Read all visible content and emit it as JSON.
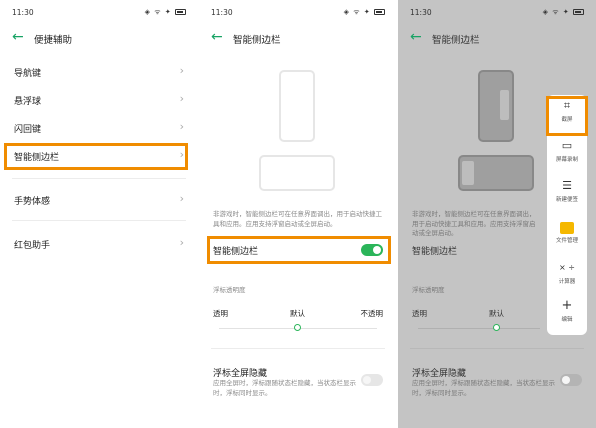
{
  "status": {
    "time": "11:30",
    "icons": "◈ ᯤ ✦"
  },
  "panel1": {
    "title": "便捷辅助",
    "items": [
      {
        "label": "导航键"
      },
      {
        "label": "悬浮球"
      },
      {
        "label": "闪回键"
      },
      {
        "label": "智能侧边栏"
      },
      {
        "label": "手势体感"
      },
      {
        "label": "红包助手"
      }
    ],
    "chevron": "›"
  },
  "panel2": {
    "title": "智能侧边栏",
    "description": "非游戏时，智能侧边栏可在任意界面调出，用于启动快捷工具和应用。应用支持浮窗启动或全屏启动。",
    "toggle_label": "智能侧边栏",
    "toggle_on": true,
    "opacity_section": "浮标透明度",
    "slider_labels": {
      "left": "透明",
      "center": "默认",
      "right": "不透明"
    },
    "slider_value": "默认",
    "fullscreen_hide_title": "浮标全屏隐藏",
    "fullscreen_hide_desc": "应用全屏时，浮标跟随状态栏隐藏，当状态栏显示时，浮标同时显示。",
    "fullscreen_hide_on": false
  },
  "panel3": {
    "title": "智能侧边栏",
    "sidebar_items": [
      {
        "label": "截屏",
        "icon": "crop-icon"
      },
      {
        "label": "屏幕录制",
        "icon": "screen-record-icon"
      },
      {
        "label": "新建便签",
        "icon": "note-icon"
      },
      {
        "label": "文件管理",
        "icon": "folder-icon"
      },
      {
        "label": "计算器",
        "icon": "calculator-icon"
      },
      {
        "label": "编辑",
        "icon": "plus-icon"
      }
    ]
  },
  "colors": {
    "accent": "#2bb55a",
    "highlight": "#f08c00",
    "back_arrow": "#17a364"
  }
}
